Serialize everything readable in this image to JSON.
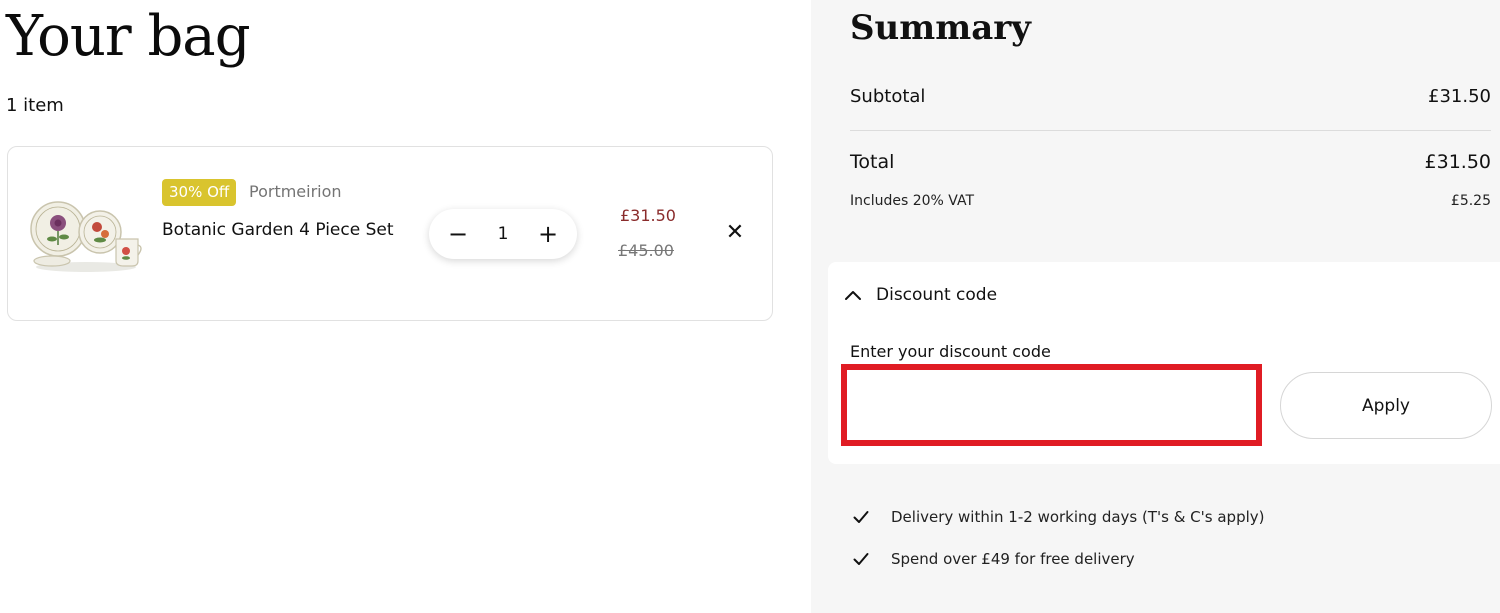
{
  "page": {
    "title": "Your bag",
    "item_count": "1 item"
  },
  "cart": {
    "items": [
      {
        "badge": "30% Off",
        "brand": "Portmeirion",
        "name": "Botanic Garden 4 Piece Set",
        "quantity": "1",
        "price_now": "£31.50",
        "price_was": "£45.00",
        "minus_symbol": "−",
        "plus_symbol": "+",
        "remove_symbol": "✕"
      }
    ]
  },
  "summary": {
    "title": "Summary",
    "subtotal_label": "Subtotal",
    "subtotal_value": "£31.50",
    "total_label": "Total",
    "total_value": "£31.50",
    "vat_label": "Includes 20% VAT",
    "vat_value": "£5.25"
  },
  "discount": {
    "toggle_label": "Discount code",
    "input_label": "Enter your discount code",
    "input_value": "",
    "apply_label": "Apply"
  },
  "benefits": [
    {
      "text": "Delivery within 1-2 working days (T's & C's apply)"
    },
    {
      "text": "Spend over £49 for free delivery"
    }
  ],
  "colors": {
    "badge": "#d9c42e",
    "sale_price": "#8a2b2b",
    "focus_outline": "#e01c24",
    "summary_bg": "#f6f6f6"
  },
  "icons": {
    "chevron": "chevron-up-icon",
    "check": "check-icon",
    "remove": "close-icon"
  }
}
